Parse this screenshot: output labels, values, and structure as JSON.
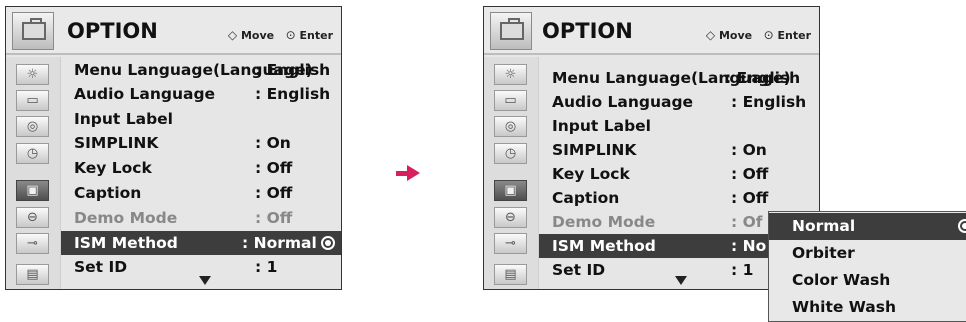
{
  "menus": [
    {
      "title": "OPTION",
      "hint_move_glyph": "◇",
      "hint_move": "Move",
      "hint_enter_glyph": "⊙",
      "hint_enter": "Enter",
      "items": [
        {
          "label": "Menu Language(Language)",
          "value": ": English"
        },
        {
          "label": "Audio Language",
          "value": ": English"
        },
        {
          "label": "Input Label",
          "value": ""
        },
        {
          "label": "SIMPLINK",
          "value": ": On"
        },
        {
          "label": "Key Lock",
          "value": ": Off"
        },
        {
          "label": "Caption",
          "value": ": Off"
        },
        {
          "label": "Demo Mode",
          "value": ": Off"
        },
        {
          "label": "ISM Method",
          "value": ": Normal"
        },
        {
          "label": "Set ID",
          "value": ": 1"
        }
      ]
    },
    {
      "title": "OPTION",
      "hint_move_glyph": "◇",
      "hint_move": "Move",
      "hint_enter_glyph": "⊙",
      "hint_enter": "Enter",
      "items": [
        {
          "label": "Menu Language(Language)",
          "value": ": English"
        },
        {
          "label": "Audio Language",
          "value": ": English"
        },
        {
          "label": "Input Label",
          "value": ""
        },
        {
          "label": "SIMPLINK",
          "value": ": On"
        },
        {
          "label": "Key Lock",
          "value": ": Off"
        },
        {
          "label": "Caption",
          "value": ": Off"
        },
        {
          "label": "Demo Mode",
          "value": ": Of"
        },
        {
          "label": "ISM Method",
          "value": ": No"
        },
        {
          "label": "Set ID",
          "value": ": 1"
        }
      ]
    }
  ],
  "side_icons": [
    {
      "name": "picture",
      "glyph": "☼"
    },
    {
      "name": "tv",
      "glyph": "▭"
    },
    {
      "name": "audio",
      "glyph": "◎"
    },
    {
      "name": "time",
      "glyph": "◷"
    },
    {
      "name": "option",
      "glyph": "▣"
    },
    {
      "name": "lock",
      "glyph": "⊖"
    },
    {
      "name": "input",
      "glyph": "⊸"
    },
    {
      "name": "usb",
      "glyph": "▤"
    }
  ],
  "ism_options": [
    "Normal",
    "Orbiter",
    "Color Wash",
    "White Wash"
  ],
  "colors": {
    "accent_arrow": "#d81e5b",
    "highlight": "#3d3d3d"
  }
}
